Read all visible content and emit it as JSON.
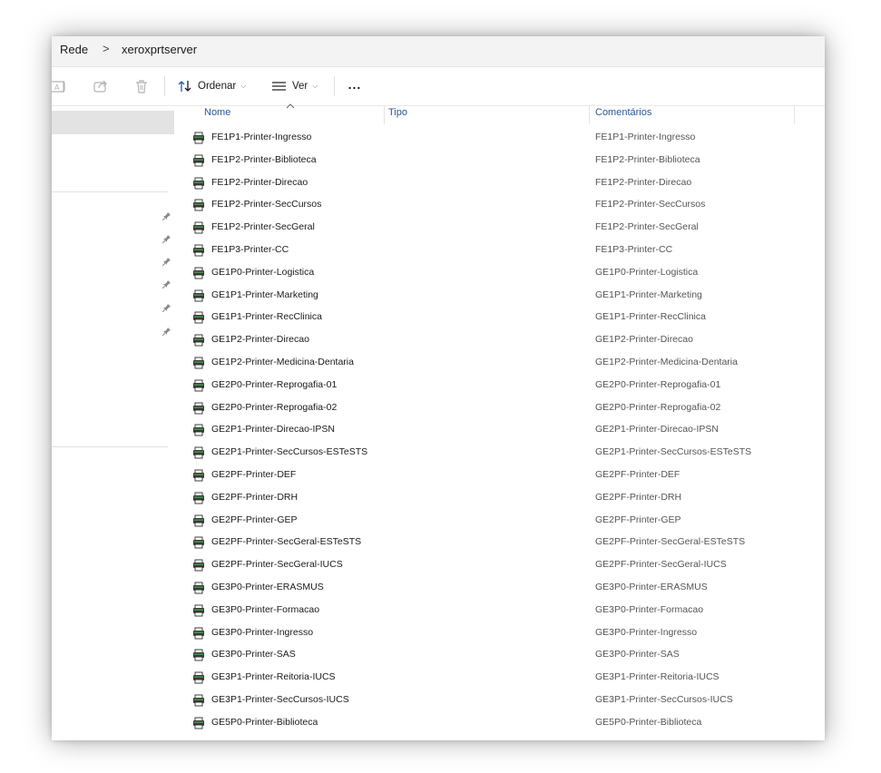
{
  "breadcrumb": {
    "root": "Rede",
    "separator": ">",
    "current": "xeroxprtserver"
  },
  "toolbar": {
    "icons": [
      "rename-icon",
      "share-icon",
      "delete-icon"
    ],
    "sort_label": "Ordenar",
    "view_label": "Ver",
    "more_label": "..."
  },
  "columns": {
    "name": "Nome",
    "type": "Tipo",
    "comments": "Comentários"
  },
  "printers": [
    {
      "name": "FE1P1-Printer-Ingresso",
      "comment": "FE1P1-Printer-Ingresso"
    },
    {
      "name": "FE1P2-Printer-Biblioteca",
      "comment": "FE1P2-Printer-Biblioteca"
    },
    {
      "name": "FE1P2-Printer-Direcao",
      "comment": "FE1P2-Printer-Direcao"
    },
    {
      "name": "FE1P2-Printer-SecCursos",
      "comment": "FE1P2-Printer-SecCursos"
    },
    {
      "name": "FE1P2-Printer-SecGeral",
      "comment": "FE1P2-Printer-SecGeral"
    },
    {
      "name": "FE1P3-Printer-CC",
      "comment": "FE1P3-Printer-CC"
    },
    {
      "name": "GE1P0-Printer-Logistica",
      "comment": "GE1P0-Printer-Logistica"
    },
    {
      "name": "GE1P1-Printer-Marketing",
      "comment": "GE1P1-Printer-Marketing"
    },
    {
      "name": "GE1P1-Printer-RecClinica",
      "comment": "GE1P1-Printer-RecClinica"
    },
    {
      "name": "GE1P2-Printer-Direcao",
      "comment": "GE1P2-Printer-Direcao"
    },
    {
      "name": "GE1P2-Printer-Medicina-Dentaria",
      "comment": "GE1P2-Printer-Medicina-Dentaria"
    },
    {
      "name": "GE2P0-Printer-Reprogafia-01",
      "comment": "GE2P0-Printer-Reprogafia-01"
    },
    {
      "name": "GE2P0-Printer-Reprogafia-02",
      "comment": "GE2P0-Printer-Reprogafia-02"
    },
    {
      "name": "GE2P1-Printer-Direcao-IPSN",
      "comment": "GE2P1-Printer-Direcao-IPSN"
    },
    {
      "name": "GE2P1-Printer-SecCursos-ESTeSTS",
      "comment": "GE2P1-Printer-SecCursos-ESTeSTS"
    },
    {
      "name": "GE2PF-Printer-DEF",
      "comment": "GE2PF-Printer-DEF"
    },
    {
      "name": "GE2PF-Printer-DRH",
      "comment": "GE2PF-Printer-DRH"
    },
    {
      "name": "GE2PF-Printer-GEP",
      "comment": "GE2PF-Printer-GEP"
    },
    {
      "name": "GE2PF-Printer-SecGeral-ESTeSTS",
      "comment": "GE2PF-Printer-SecGeral-ESTeSTS"
    },
    {
      "name": "GE2PF-Printer-SecGeral-IUCS",
      "comment": "GE2PF-Printer-SecGeral-IUCS"
    },
    {
      "name": "GE3P0-Printer-ERASMUS",
      "comment": "GE3P0-Printer-ERASMUS"
    },
    {
      "name": "GE3P0-Printer-Formacao",
      "comment": "GE3P0-Printer-Formacao"
    },
    {
      "name": "GE3P0-Printer-Ingresso",
      "comment": "GE3P0-Printer-Ingresso"
    },
    {
      "name": "GE3P0-Printer-SAS",
      "comment": "GE3P0-Printer-SAS"
    },
    {
      "name": "GE3P1-Printer-Reitoria-IUCS",
      "comment": "GE3P1-Printer-Reitoria-IUCS"
    },
    {
      "name": "GE3P1-Printer-SecCursos-IUCS",
      "comment": "GE3P1-Printer-SecCursos-IUCS"
    },
    {
      "name": "GE5P0-Printer-Biblioteca",
      "comment": "GE5P0-Printer-Biblioteca"
    }
  ],
  "colors": {
    "accent": "#2b5797",
    "selection": "#e3e3e3"
  }
}
